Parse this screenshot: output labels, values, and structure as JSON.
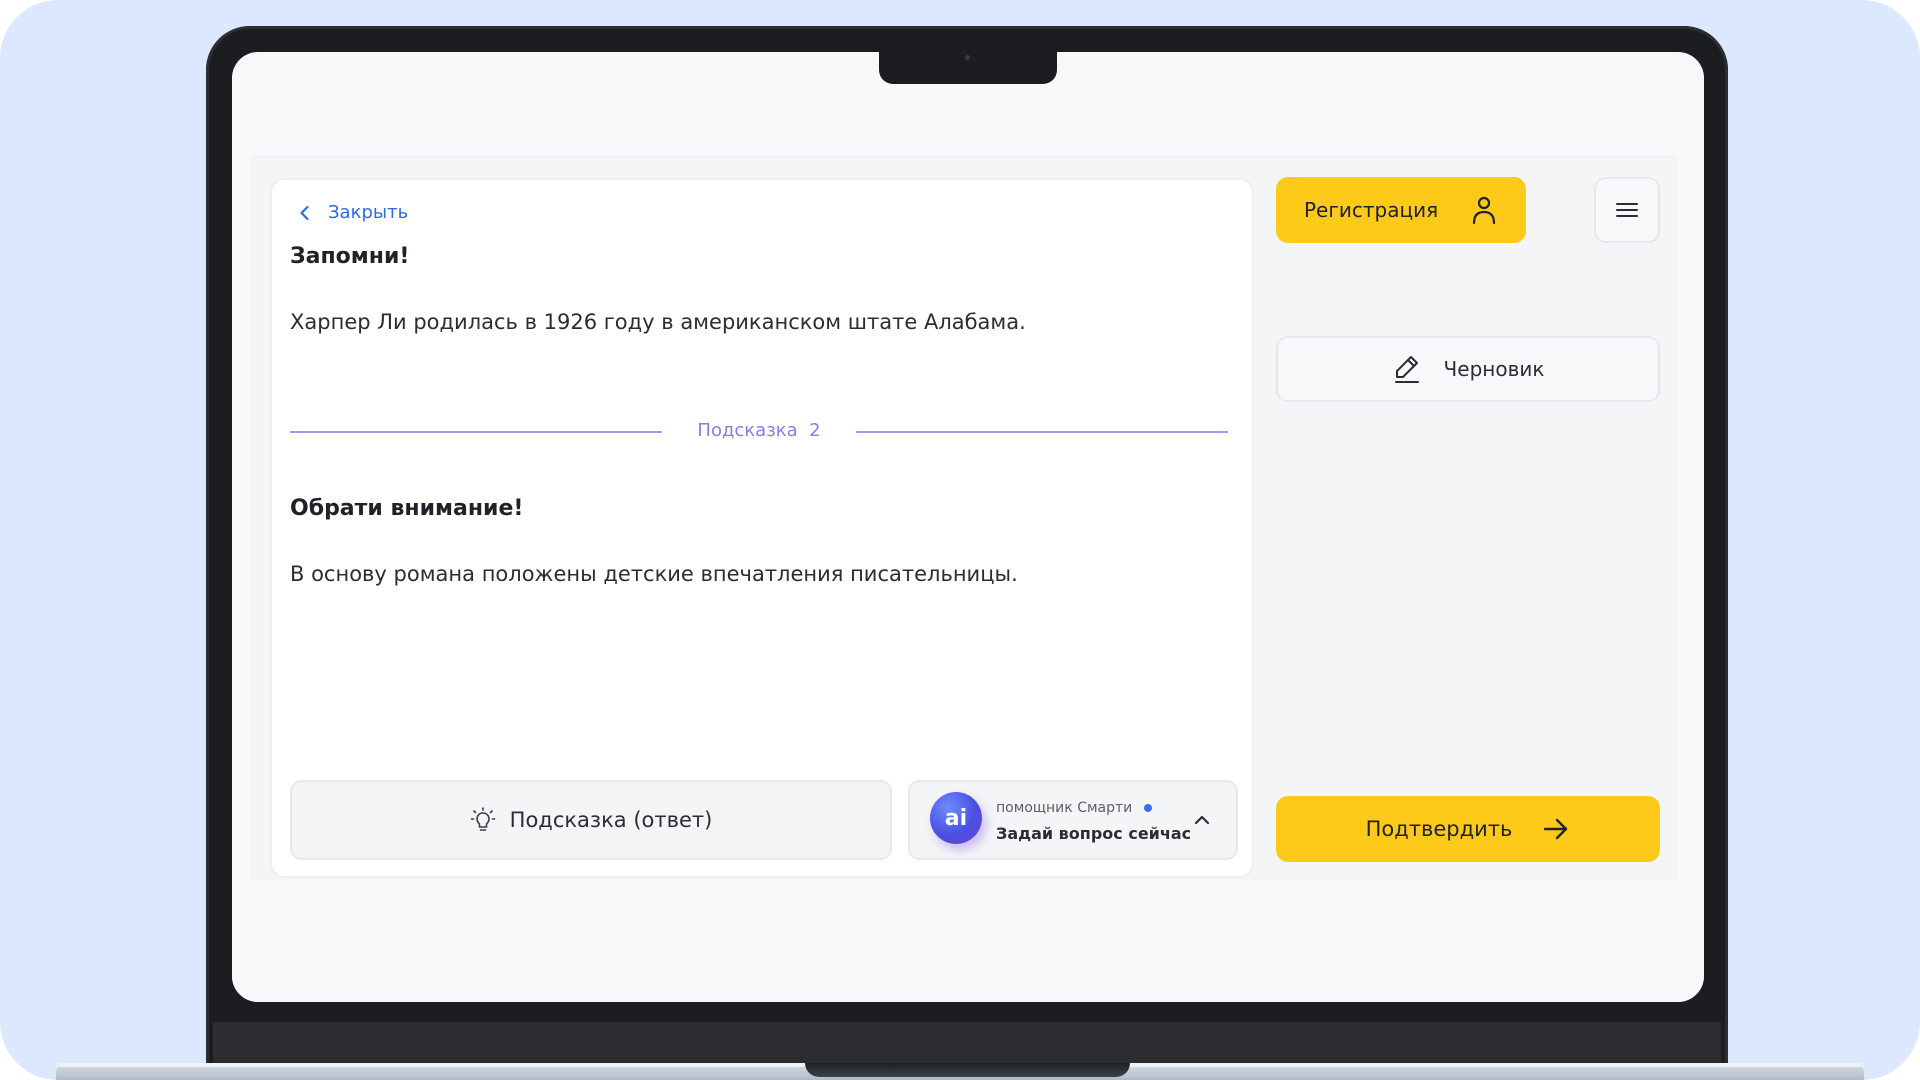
{
  "close": {
    "label": "Закрыть",
    "icon": "chevron-left-icon"
  },
  "content": {
    "remember_title": "Запомни!",
    "remember_text": "Харпер Ли родилась в 1926 году в американском штате Алабама.",
    "divider_label": "Подсказка  2",
    "attention_title": "Обрати внимание!",
    "attention_text": "В основу романа положены детские впечатления писательницы."
  },
  "hint_button": {
    "label": "Подсказка (ответ)",
    "icon": "lightbulb-icon"
  },
  "assistant": {
    "avatar": "ai",
    "name": "помощник Смарти",
    "cta": "Задай вопрос сейчас",
    "status_color": "#3e6cf0",
    "icon": "chevron-up-icon"
  },
  "sidebar": {
    "register_label": "Регистрация",
    "register_icon": "user-icon",
    "menu_icon": "menu-icon",
    "draft_label": "Черновик",
    "draft_icon": "pencil-icon",
    "confirm_label": "Подтвердить",
    "confirm_icon": "arrow-right-icon"
  },
  "colors": {
    "accent_yellow": "#fdca1a",
    "link_blue": "#2f6ae0",
    "hint_purple": "#8a7be0",
    "background": "#dbe8fd"
  }
}
